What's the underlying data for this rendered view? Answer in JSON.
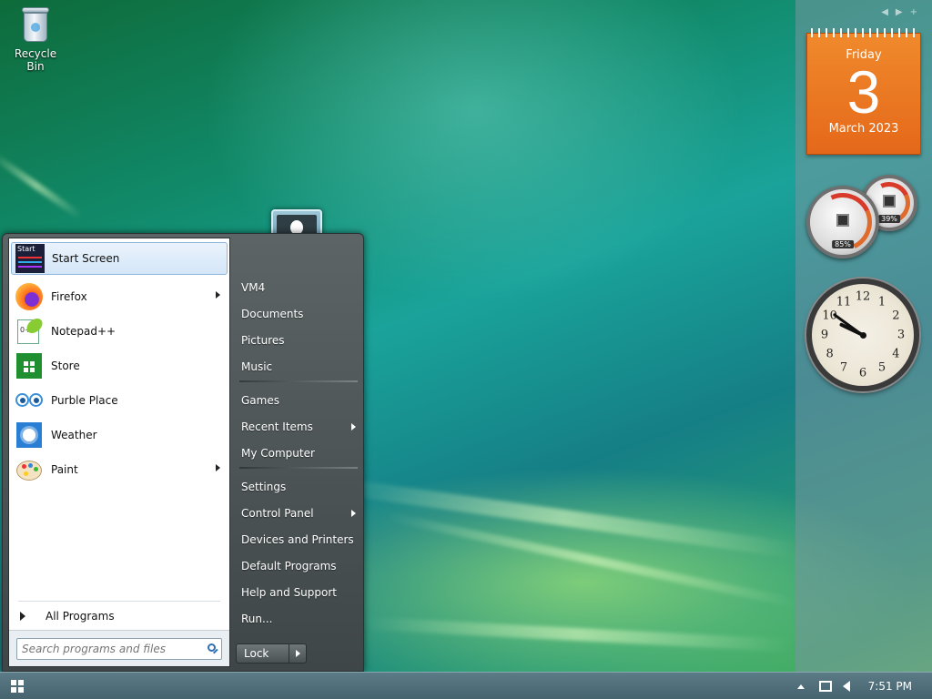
{
  "desktop": {
    "icons": [
      {
        "label": "Recycle Bin",
        "icon": "recycle-bin-icon"
      }
    ]
  },
  "sidebar": {
    "calendar": {
      "weekday": "Friday",
      "day": "3",
      "month_year": "March 2023"
    },
    "meters": {
      "cpu_percent": "85%",
      "memory_percent": "39%"
    },
    "clock": {
      "numerals": [
        "12",
        "1",
        "2",
        "3",
        "4",
        "5",
        "6",
        "7",
        "8",
        "9",
        "10",
        "11"
      ],
      "hour": 9,
      "minute": 51
    }
  },
  "start_menu": {
    "programs": [
      {
        "label": "Start Screen",
        "icon": "start-screen-icon",
        "highlighted": true,
        "submenu": false
      },
      {
        "label": "Firefox",
        "icon": "firefox-icon",
        "submenu": true
      },
      {
        "label": "Notepad++",
        "icon": "notepad-plus-plus-icon",
        "submenu": false
      },
      {
        "label": "Store",
        "icon": "store-icon",
        "submenu": false
      },
      {
        "label": "Purble Place",
        "icon": "purble-place-icon",
        "submenu": false
      },
      {
        "label": "Weather",
        "icon": "weather-icon",
        "submenu": false
      },
      {
        "label": "Paint",
        "icon": "paint-icon",
        "submenu": true
      }
    ],
    "all_programs": "All Programs",
    "search_placeholder": "Search programs and files",
    "right_items": [
      {
        "label": "VM4",
        "submenu": false
      },
      {
        "label": "Documents",
        "submenu": false
      },
      {
        "label": "Pictures",
        "submenu": false
      },
      {
        "label": "Music",
        "submenu": false
      },
      {
        "label": "Games",
        "submenu": false
      },
      {
        "label": "Recent Items",
        "submenu": true
      },
      {
        "label": "My Computer",
        "submenu": false
      },
      {
        "label": "Settings",
        "submenu": false
      },
      {
        "label": "Control Panel",
        "submenu": true
      },
      {
        "label": "Devices and Printers",
        "submenu": false
      },
      {
        "label": "Default Programs",
        "submenu": false
      },
      {
        "label": "Help and Support",
        "submenu": false
      },
      {
        "label": "Run...",
        "submenu": false
      }
    ],
    "lock_label": "Lock",
    "start_tile_text": "Start"
  },
  "taskbar": {
    "time": "7:51 PM"
  },
  "colors": {
    "calendar": "#e86f1f",
    "accent": "#2f6fb5",
    "taskbar": "#4f6d78"
  }
}
